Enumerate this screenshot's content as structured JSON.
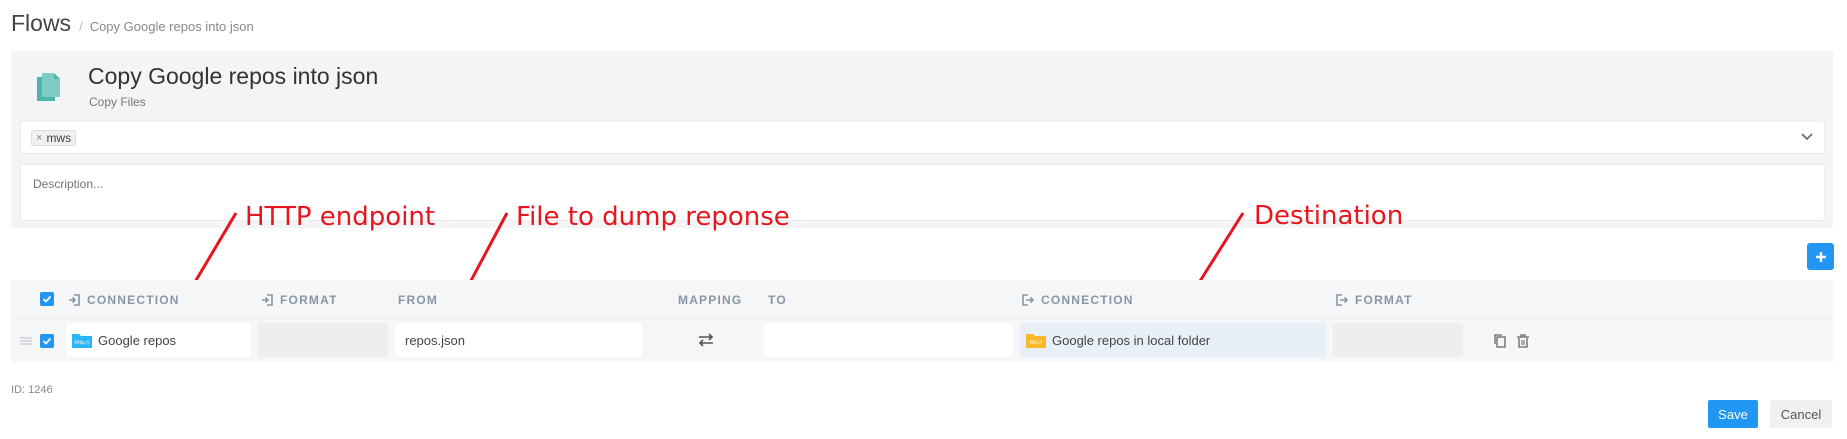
{
  "breadcrumb": {
    "root": "Flows",
    "separator": "/",
    "current": "Copy Google repos into json"
  },
  "flow": {
    "title": "Copy Google repos into json",
    "subtitle": "Copy Files",
    "icon": "copy-files-icon",
    "tags": [
      {
        "remove": "×",
        "label": "mws"
      }
    ],
    "description_placeholder": "Description..."
  },
  "annotations": {
    "http": "HTTP endpoint",
    "file": "File to dump reponse",
    "destination": "Destination",
    "color": "#e8141e"
  },
  "table": {
    "headers": {
      "connection": "CONNECTION",
      "format": "FORMAT",
      "from": "FROM",
      "mapping": "MAPPING",
      "to": "TO",
      "dest_connection": "CONNECTION",
      "dest_format": "FORMAT"
    },
    "row": {
      "checked": true,
      "source_connection": "Google repos",
      "source_connection_icon_text": "http://",
      "source_format": "",
      "from": "repos.json",
      "to": "",
      "dest_connection": "Google repos in local folder",
      "dest_connection_icon_text": "file://",
      "dest_format": ""
    }
  },
  "footer": {
    "id_label": "ID: 1246",
    "save": "Save",
    "cancel": "Cancel"
  },
  "colors": {
    "accent": "#2196f3",
    "header_text": "#8a96a6",
    "panel_bg": "#f3f4f6",
    "http_icon": "#29b6f6",
    "file_icon": "#fbb829"
  }
}
